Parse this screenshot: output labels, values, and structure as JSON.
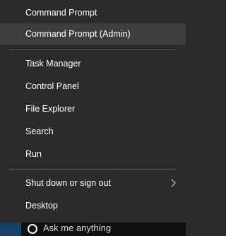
{
  "menu": {
    "items": [
      {
        "label": "Command Prompt"
      },
      {
        "label": "Command Prompt (Admin)"
      },
      {
        "label": "Task Manager"
      },
      {
        "label": "Control Panel"
      },
      {
        "label": "File Explorer"
      },
      {
        "label": "Search"
      },
      {
        "label": "Run"
      },
      {
        "label": "Shut down or sign out"
      },
      {
        "label": "Desktop"
      }
    ]
  },
  "taskbar": {
    "search_placeholder": "Ask me anything"
  },
  "icons": {
    "submenu": "chevron-right-icon",
    "search": "cortana-circle-icon"
  },
  "colors": {
    "menu_bg": "#2b2b2b",
    "highlight": "#3d3d3d",
    "text": "#ffffff",
    "separator": "#5a5a5a",
    "taskbar": "#101010"
  }
}
